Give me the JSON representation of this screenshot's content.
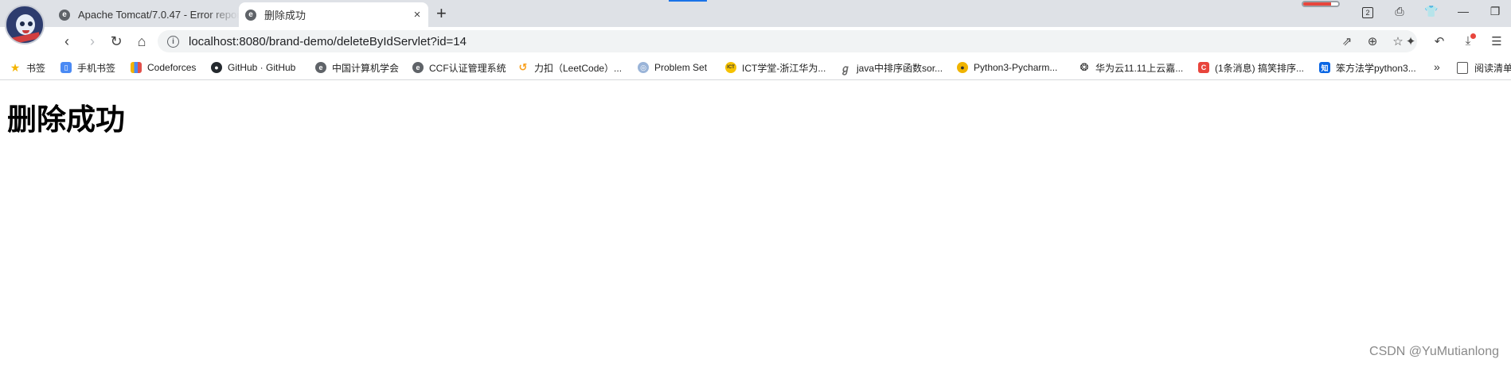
{
  "window": {
    "tabs": [
      {
        "title": "Apache Tomcat/7.0.47 - Error report",
        "active": false
      },
      {
        "title": "删除成功",
        "active": true,
        "close": "×"
      }
    ],
    "new_tab": "+",
    "icons": {
      "tab_favicon": "tomcat-e-icon",
      "profile_avatar": "anime-avatar",
      "system": [
        "grid-icon",
        "printer-icon",
        "shirt-icon",
        "minimize-icon",
        "restore-icon"
      ]
    },
    "progress_fraction": 0.8,
    "accent_color": "#1a73e8",
    "badge_color": "#e8453c",
    "ime_indicator": "2"
  },
  "toolbar": {
    "url": "localhost:8080/brand-demo/deleteByIdServlet?id=14"
  },
  "bookmarks": [
    {
      "label": "书签",
      "icon": "star-icon",
      "color": "#f4b400"
    },
    {
      "label": "手机书签",
      "icon": "phone-bookmark-icon",
      "color": "#4a8af4"
    },
    {
      "label": "Codeforces",
      "icon": "bars-icon",
      "color": "#e2504b"
    },
    {
      "label": "GitHub · GitHub",
      "icon": "github-icon",
      "color": "#24292e"
    },
    {
      "label": "中国计算机学会",
      "icon": "ccf-icon",
      "color": "#5f6368"
    },
    {
      "label": "CCF认证管理系统",
      "icon": "ccf-icon",
      "color": "#5f6368"
    },
    {
      "label": "力扣（LeetCode）...",
      "icon": "leetcode-icon",
      "color": "#f89f1b"
    },
    {
      "label": "Problem Set",
      "icon": "globe-icon",
      "color": "#9ab4d8"
    },
    {
      "label": "ICT学堂-浙江华为...",
      "icon": "ict-icon",
      "color": "#f6c200"
    },
    {
      "label": "java中排序函数sor...",
      "icon": "cursive-icon",
      "color": "#666666"
    },
    {
      "label": "Python3-Pycharm...",
      "icon": "bear-icon",
      "color": "#f0b400"
    },
    {
      "label": "华为云11.11上云嘉...",
      "icon": "huawei-icon",
      "color": "#222222"
    },
    {
      "label": "(1条消息) 搞笑排序...",
      "icon": "csdn-c-icon",
      "color": "#e8453c"
    },
    {
      "label": "笨方法学python3...",
      "icon": "zhihu-icon",
      "color": "#0a66e4"
    }
  ],
  "bookmarks_more": "»",
  "reading_list": "阅读清单",
  "content": {
    "heading": "删除成功"
  },
  "watermark": "CSDN @YuMutianlong"
}
